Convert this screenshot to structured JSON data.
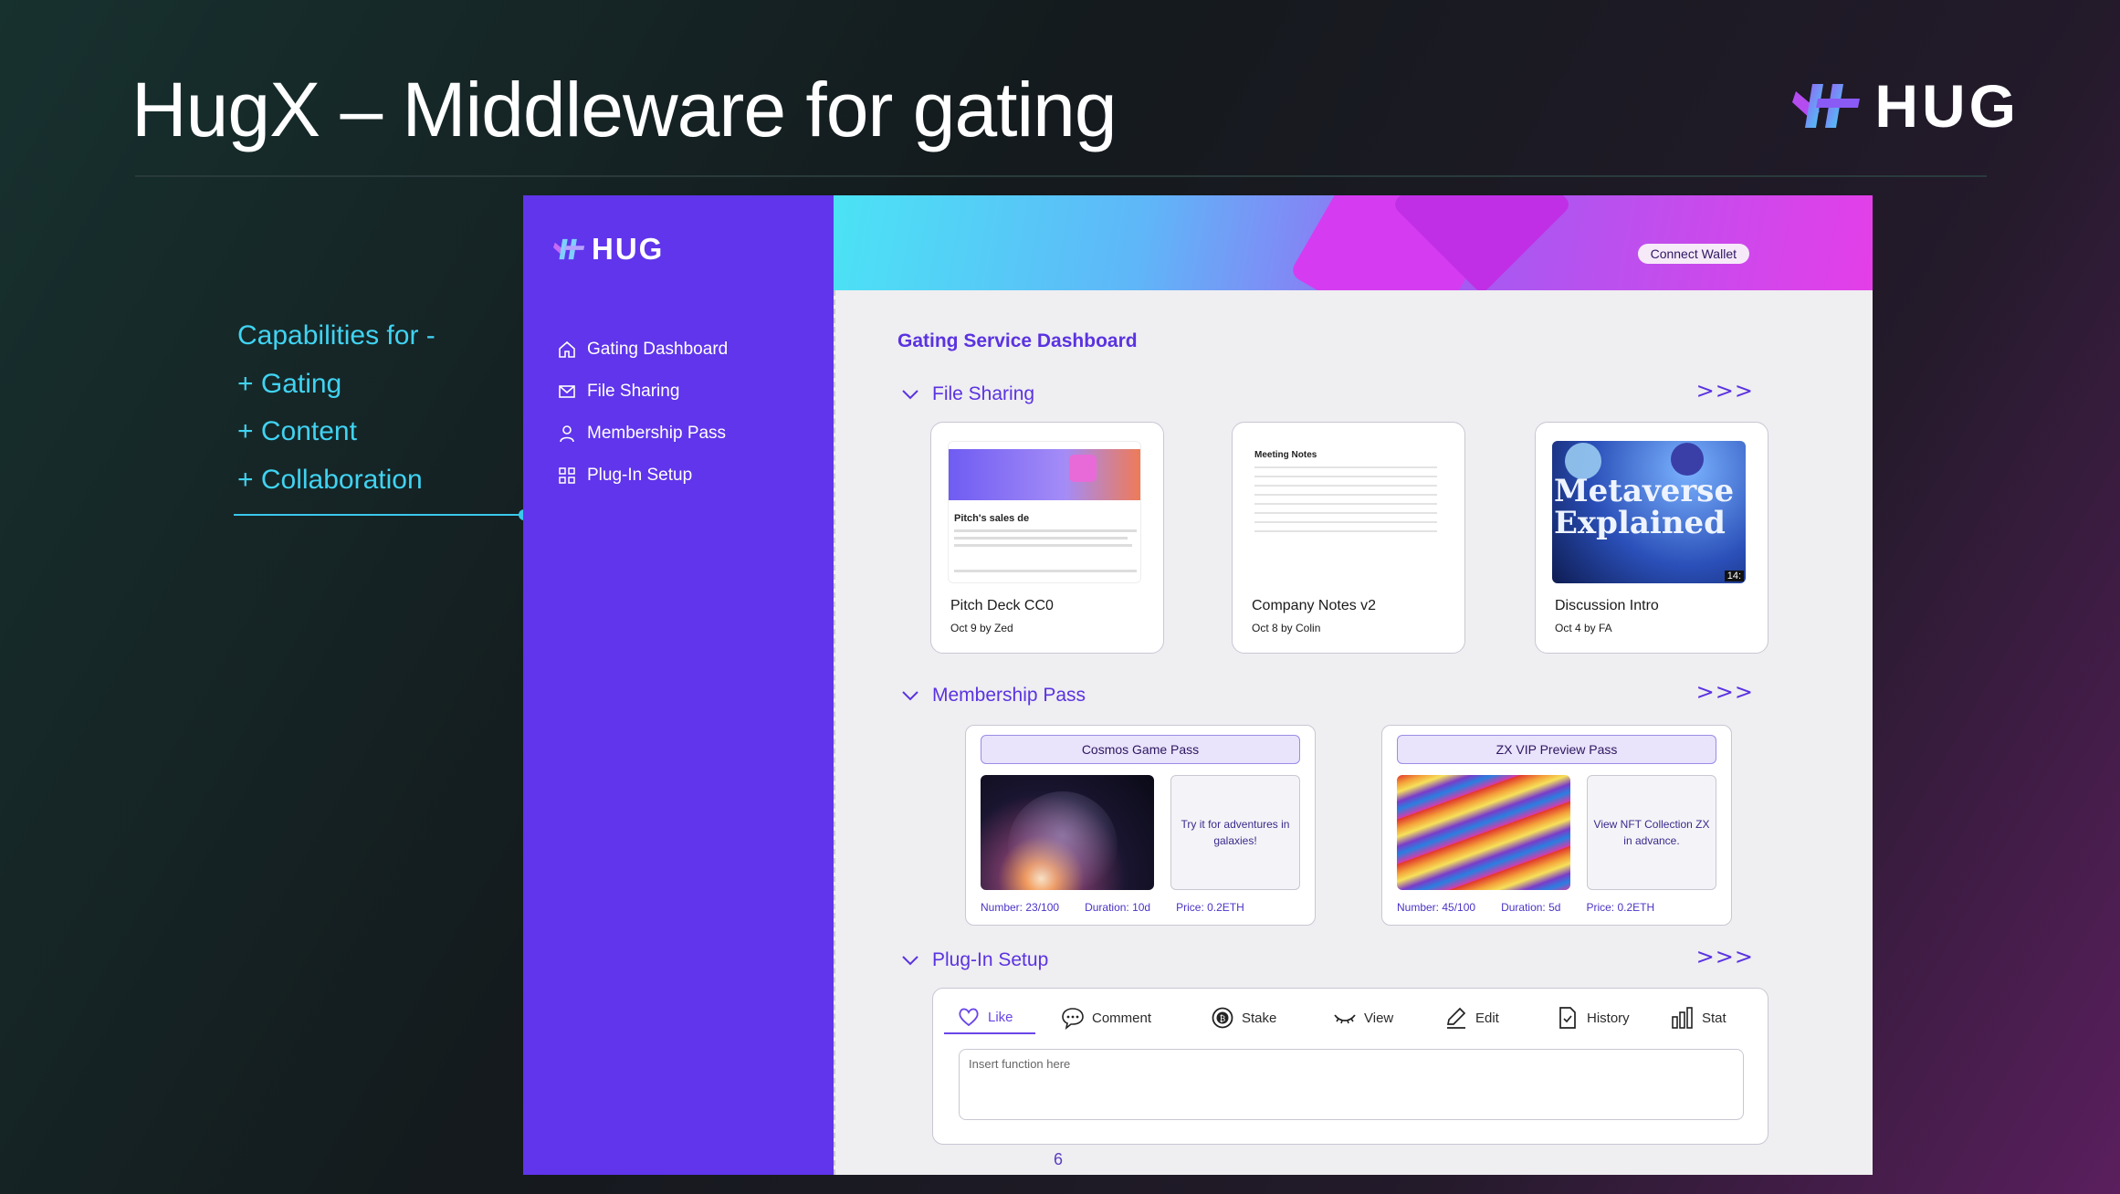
{
  "slide": {
    "title": "HugX – Middleware for gating",
    "brand": "HUG",
    "page_number": "6"
  },
  "capabilities": {
    "lines": [
      "Capabilities for -",
      "+ Gating",
      "+ Content",
      "+ Collaboration"
    ]
  },
  "app": {
    "brand": "HUG",
    "connect_wallet": "Connect Wallet",
    "nav": [
      {
        "label": "Gating Dashboard",
        "icon": "home-icon"
      },
      {
        "label": "File Sharing",
        "icon": "mail-icon"
      },
      {
        "label": "Membership Pass",
        "icon": "user-icon"
      },
      {
        "label": "Plug-In Setup",
        "icon": "grid-icon"
      }
    ],
    "dashboard_title": "Gating Service Dashboard",
    "sections": {
      "file_sharing": "File Sharing",
      "membership_pass": "Membership Pass",
      "plugin_setup": "Plug-In Setup",
      "more": ">>>"
    },
    "files": [
      {
        "name": "Pitch Deck CC0",
        "meta": "Oct 9 by Zed",
        "thumb_heading": "Pitch's sales de"
      },
      {
        "name": "Company Notes v2",
        "meta": "Oct 8 by Colin",
        "thumb_heading": "Meeting Notes"
      },
      {
        "name": "Discussion Intro",
        "meta": "Oct 4 by FA",
        "thumb_heading": "Metaverse Explained",
        "duration": "14:"
      }
    ],
    "passes": [
      {
        "title": "Cosmos Game Pass",
        "desc": "Try it for adventures in galaxies!",
        "number": "Number: 23/100",
        "duration": "Duration: 10d",
        "price": "Price: 0.2ETH"
      },
      {
        "title": "ZX VIP Preview Pass",
        "desc": "View NFT Collection ZX in advance.",
        "number": "Number: 45/100",
        "duration": "Duration: 5d",
        "price": "Price: 0.2ETH"
      }
    ],
    "plugin_tabs": [
      {
        "label": "Like",
        "icon": "heart-icon"
      },
      {
        "label": "Comment",
        "icon": "comment-icon"
      },
      {
        "label": "Stake",
        "icon": "coin-icon"
      },
      {
        "label": "View",
        "icon": "eye-icon"
      },
      {
        "label": "Edit",
        "icon": "pencil-icon"
      },
      {
        "label": "History",
        "icon": "document-icon"
      },
      {
        "label": "Stat",
        "icon": "bar-chart-icon"
      }
    ],
    "plugin_placeholder": "Insert function here",
    "colors": {
      "accent": "#6035eb",
      "highlight": "#40d3f2"
    }
  }
}
